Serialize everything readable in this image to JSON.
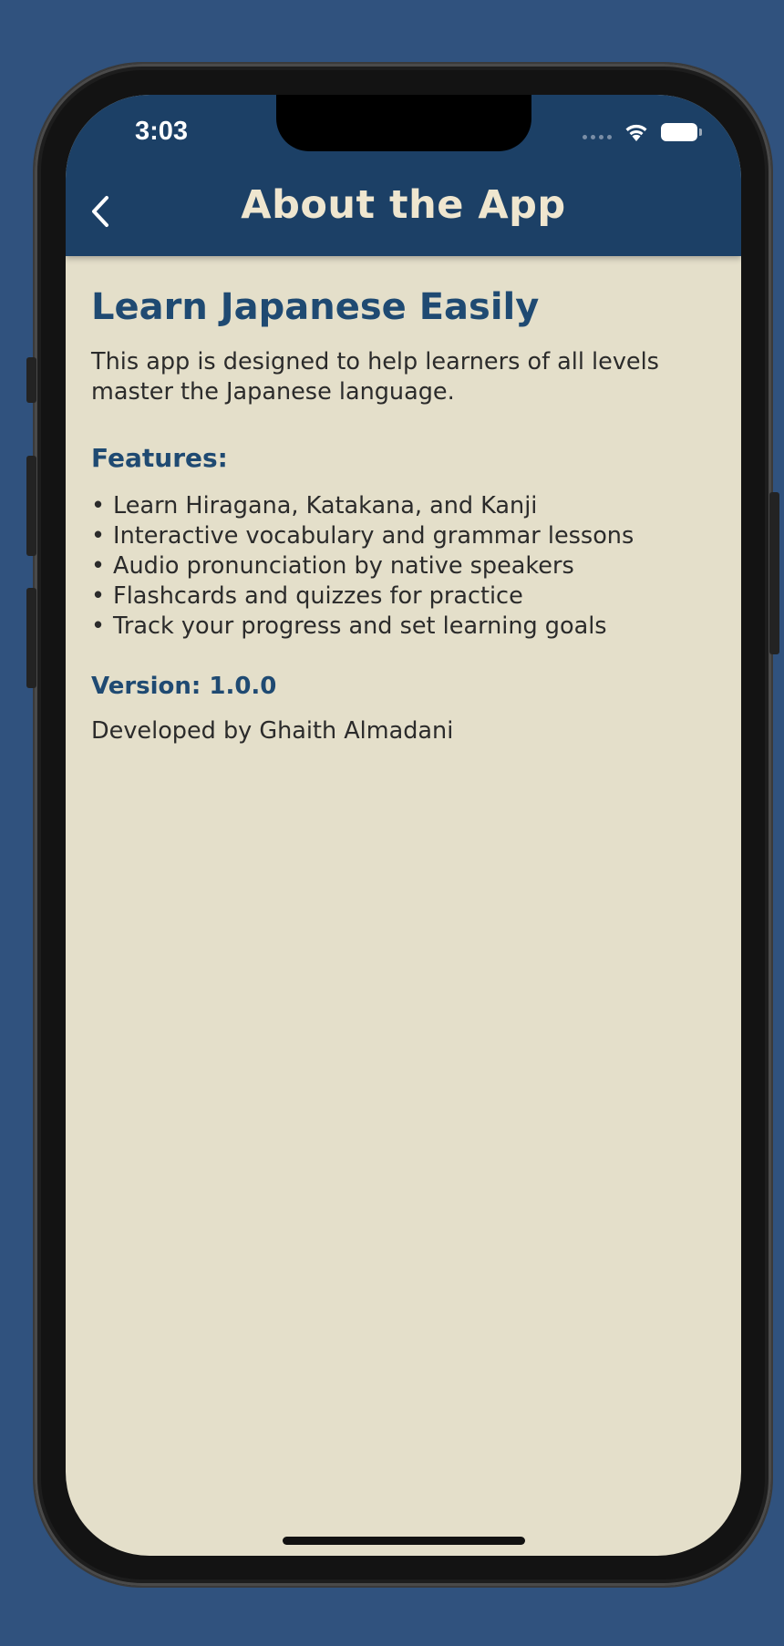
{
  "status_bar": {
    "time": "3:03",
    "icons": [
      "cellular-dots-icon",
      "wifi-icon",
      "battery-icon"
    ]
  },
  "nav": {
    "back_icon": "chevron-left-icon",
    "title": "About the App"
  },
  "about": {
    "heading": "Learn Japanese Easily",
    "intro": "This app is designed to help learners of all levels master the Japanese language.",
    "features_heading": "Features:",
    "bullet": "•",
    "features": [
      "Learn Hiragana, Katakana, and Kanji",
      "Interactive vocabulary and grammar lessons",
      "Audio pronunciation by native speakers",
      "Flashcards and quizzes for practice",
      "Track your progress and set learning goals"
    ],
    "version": "Version: 1.0.0",
    "developer": "Developed by Ghaith Almadani"
  },
  "colors": {
    "page_background": "#30527e",
    "header_background": "#1c4066",
    "screen_background": "#e4dfca",
    "title_text": "#efe6cf",
    "accent_text": "#1f4a72",
    "body_text": "#2b2b2b"
  }
}
